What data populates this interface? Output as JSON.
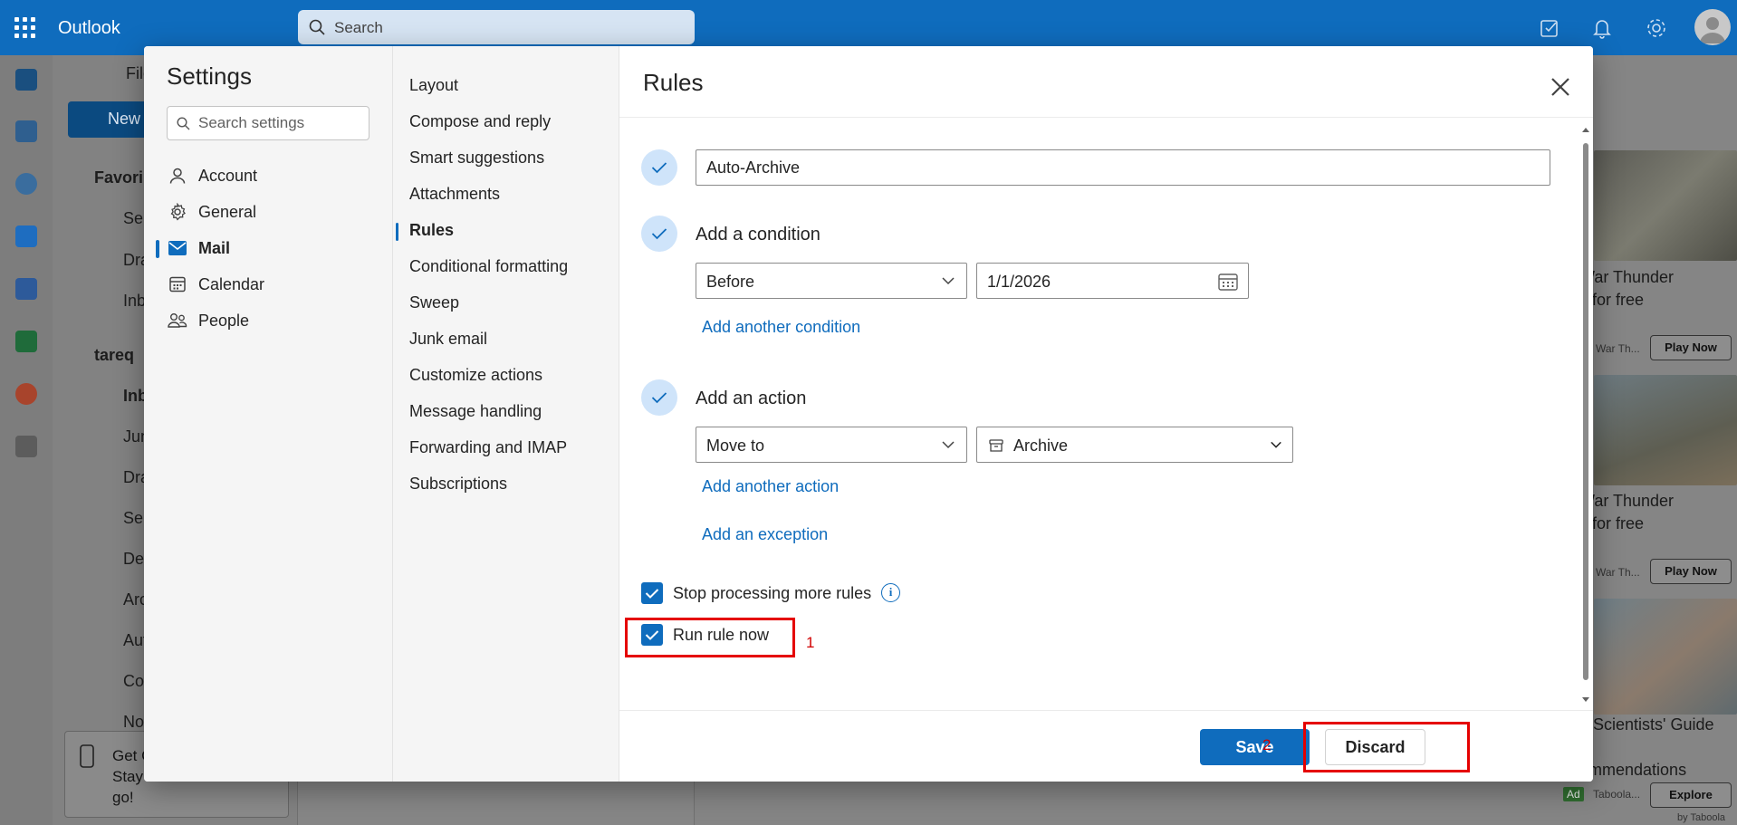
{
  "app": {
    "name": "Outlook",
    "search_placeholder": "Search"
  },
  "background": {
    "new_label": "New",
    "ribbon_partial": "File",
    "folders": [
      "Favori",
      "Ser",
      "Dra",
      "Inb",
      "tareq",
      "Inb",
      "Jun",
      "Dra",
      "Ser",
      "Del",
      "Arc",
      "Aut",
      "Co",
      "No"
    ],
    "get_app": [
      "Get C",
      "Stay connected on the",
      "go!"
    ],
    "ads": [
      {
        "line1": "War Thunder",
        "line2": "y for free",
        "source": "War Th...",
        "button": "Play Now"
      },
      {
        "line1": "War Thunder",
        "line2": "y for free",
        "source": "War Th...",
        "button": "Play Now"
      },
      {
        "line1": "a Scientists' Guide",
        "line2": "d",
        "line3": "ommendations",
        "badge": "Ad",
        "source": "Taboola...",
        "button": "Explore",
        "footer": "by Taboola"
      }
    ]
  },
  "settings": {
    "title": "Settings",
    "search_placeholder": "Search settings",
    "categories": [
      {
        "label": "Account",
        "icon": "person-icon"
      },
      {
        "label": "General",
        "icon": "gear-icon"
      },
      {
        "label": "Mail",
        "icon": "mail-icon",
        "active": true
      },
      {
        "label": "Calendar",
        "icon": "calendar-icon"
      },
      {
        "label": "People",
        "icon": "people-icon"
      }
    ],
    "mail_sections": [
      "Layout",
      "Compose and reply",
      "Smart suggestions",
      "Attachments",
      "Rules",
      "Conditional formatting",
      "Sweep",
      "Junk email",
      "Customize actions",
      "Message handling",
      "Forwarding and IMAP",
      "Subscriptions"
    ],
    "active_section": "Rules"
  },
  "rule": {
    "panel_title": "Rules",
    "name_value": "Auto-Archive",
    "condition_heading": "Add a condition",
    "condition_type": "Before",
    "condition_date": "1/1/2026",
    "add_condition_link": "Add another condition",
    "action_heading": "Add an action",
    "action_type": "Move to",
    "action_folder": "Archive",
    "add_action_link": "Add another action",
    "add_exception_link": "Add an exception",
    "stop_processing_label": "Stop processing more rules",
    "stop_processing_checked": true,
    "run_now_label": "Run rule now",
    "run_now_checked": true,
    "save_label": "Save",
    "discard_label": "Discard"
  },
  "annotations": {
    "first": "1",
    "second": "2",
    "color": "#e50000"
  },
  "colors": {
    "accent": "#0f6cbd",
    "step_bg": "#cfe4fa"
  }
}
